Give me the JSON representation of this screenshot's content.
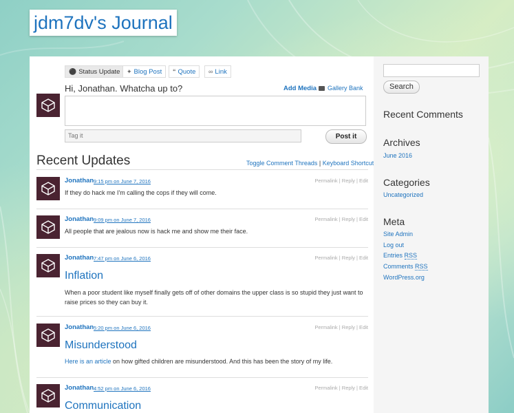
{
  "site": {
    "title": "jdm7dv's Journal"
  },
  "postbox": {
    "tabs": [
      {
        "label": "Status Update",
        "icon": "person-icon"
      },
      {
        "label": "Blog Post",
        "icon": "pin-icon"
      },
      {
        "label": "Quote",
        "icon": "quote-icon"
      },
      {
        "label": "Link",
        "icon": "link-icon"
      }
    ],
    "greeting": "Hi, Jonathan. Whatcha up to?",
    "add_media": "Add Media",
    "gallery_bank": "Gallery Bank",
    "tag_placeholder": "Tag it",
    "post_button": "Post it"
  },
  "updates": {
    "title": "Recent Updates",
    "toggle_link": "Toggle Comment Threads",
    "separator": "|",
    "shortcuts_link": "Keyboard Shortcuts",
    "actions": "Permalink | Reply | Edit",
    "entries": [
      {
        "author": "Jonathan",
        "meta": "9:15 pm on June 7, 2016",
        "text": "If they do hack me I'm calling the cops if they will come."
      },
      {
        "author": "Jonathan",
        "meta": "9:09 pm on June 7, 2016",
        "text": "All people that are jealous now is hack me and show me their face."
      },
      {
        "author": "Jonathan",
        "meta": "7:47 pm on June 6, 2016",
        "title": "Inflation",
        "text": "When a poor student like myself finally gets off of other domains the upper class is so stupid they just want to raise prices so they can buy it."
      },
      {
        "author": "Jonathan",
        "meta": "5:20 pm on June 6, 2016",
        "title": "Misunderstood",
        "link_text": "Here is an article",
        "text": " on how gifted children are misunderstood. And this has been the story of my life."
      },
      {
        "author": "Jonathan",
        "meta": "4:52 pm on June 6, 2016",
        "title": "Communication"
      }
    ]
  },
  "sidebar": {
    "search_button": "Search",
    "recent_comments": "Recent Comments",
    "archives": {
      "title": "Archives",
      "items": [
        "June 2016"
      ]
    },
    "categories": {
      "title": "Categories",
      "items": [
        "Uncategorized"
      ]
    },
    "meta": {
      "title": "Meta",
      "site_admin": "Site Admin",
      "log_out": "Log out",
      "entries_rss_prefix": "Entries ",
      "comments_rss_prefix": "Comments ",
      "rss": "RSS",
      "wordpress": "WordPress.org"
    }
  },
  "colors": {
    "link": "#1e73be",
    "avatar_bg": "#4a2331"
  }
}
